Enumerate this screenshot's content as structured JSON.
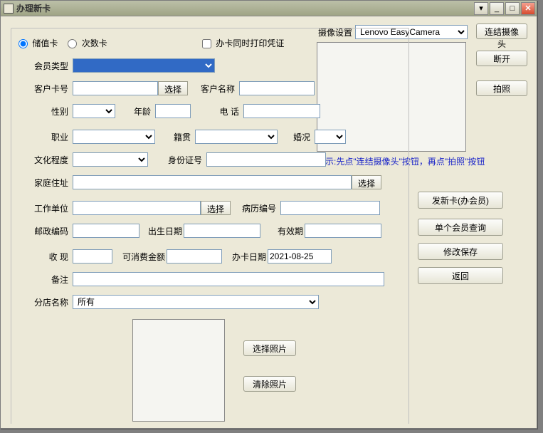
{
  "window": {
    "title": "办理新卡"
  },
  "cardType": {
    "storedValue": "储值卡",
    "count": "次数卡"
  },
  "printCheckbox": "办卡同时打印凭证",
  "camera": {
    "label": "摄像设置",
    "device": "Lenovo EasyCamera",
    "connect": "连结摄像头",
    "disconnect": "断开",
    "shoot": "拍照",
    "hint": "提示:先点\"连结摄像头\"按钮，再点\"拍照\"按钮"
  },
  "labels": {
    "memberType": "会员类型",
    "cardNo": "客户卡号",
    "custName": "客户名称",
    "gender": "性别",
    "age": "年龄",
    "phone": "电     话",
    "job": "职业",
    "native": "籍贯",
    "marriage": "婚况",
    "edu": "文化程度",
    "idNo": "身份证号",
    "homeAddr": "家庭住址",
    "workUnit": "工作单位",
    "recordNo": "病历编号",
    "zip": "邮政编码",
    "birth": "出生日期",
    "expire": "有效期",
    "cash": "收     现",
    "consumable": "可消费金额",
    "cardDate": "办卡日期",
    "remark": "备注",
    "branch": "分店名称"
  },
  "values": {
    "cardDate": "2021-08-25",
    "branch": "所有"
  },
  "buttons": {
    "select": "选择",
    "selectPhoto": "选择照片",
    "clearPhoto": "清除照片",
    "issue": "发新卡(办会员)",
    "query": "单个会员查询",
    "save": "修改保存",
    "back": "返回"
  }
}
